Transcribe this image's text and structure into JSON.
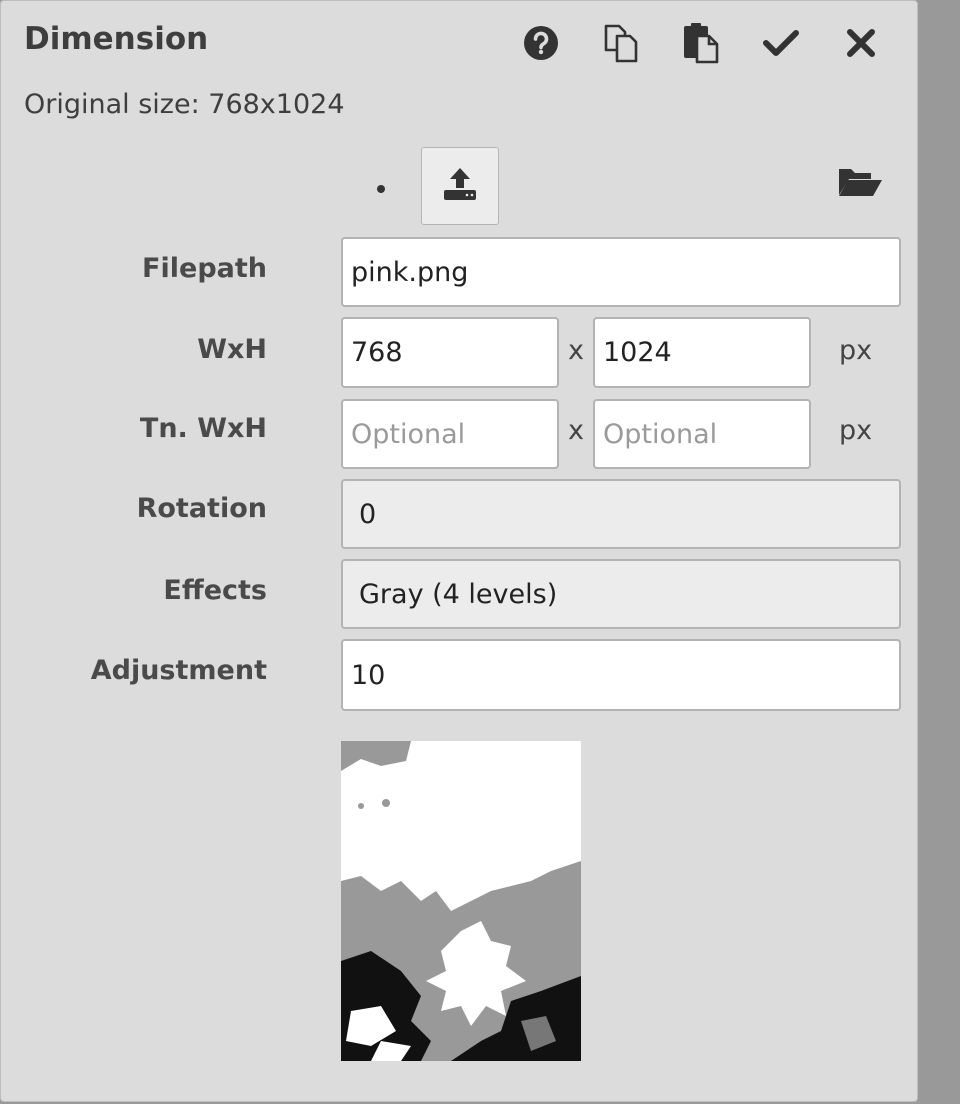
{
  "dialog": {
    "title": "Dimension",
    "original_size": "Original size: 768x1024"
  },
  "toolbar": {
    "buttons": [
      {
        "name": "help",
        "icon": "help-circle-icon"
      },
      {
        "name": "copy",
        "icon": "copy-icon"
      },
      {
        "name": "paste",
        "icon": "paste-icon"
      },
      {
        "name": "confirm",
        "icon": "check-icon"
      },
      {
        "name": "close",
        "icon": "close-icon"
      }
    ]
  },
  "file": {
    "upload_icon": "upload-icon",
    "open_icon": "folder-open-icon"
  },
  "form": {
    "filepath_label": "Filepath",
    "filepath_value": "pink.png",
    "wxh_label": "WxH",
    "width_value": "768",
    "height_value": "1024",
    "x_sep": "x",
    "px_unit": "px",
    "tn_wxh_label": "Tn. WxH",
    "tn_width_placeholder": "Optional",
    "tn_height_placeholder": "Optional",
    "rotation_label": "Rotation",
    "rotation_value": "0",
    "effects_label": "Effects",
    "effects_value": "Gray (4 levels)",
    "adjustment_label": "Adjustment",
    "adjustment_value": "10"
  },
  "colors": {
    "panel_bg": "#dcdcdc",
    "scrollbar": "#999999",
    "icon": "#333333"
  }
}
